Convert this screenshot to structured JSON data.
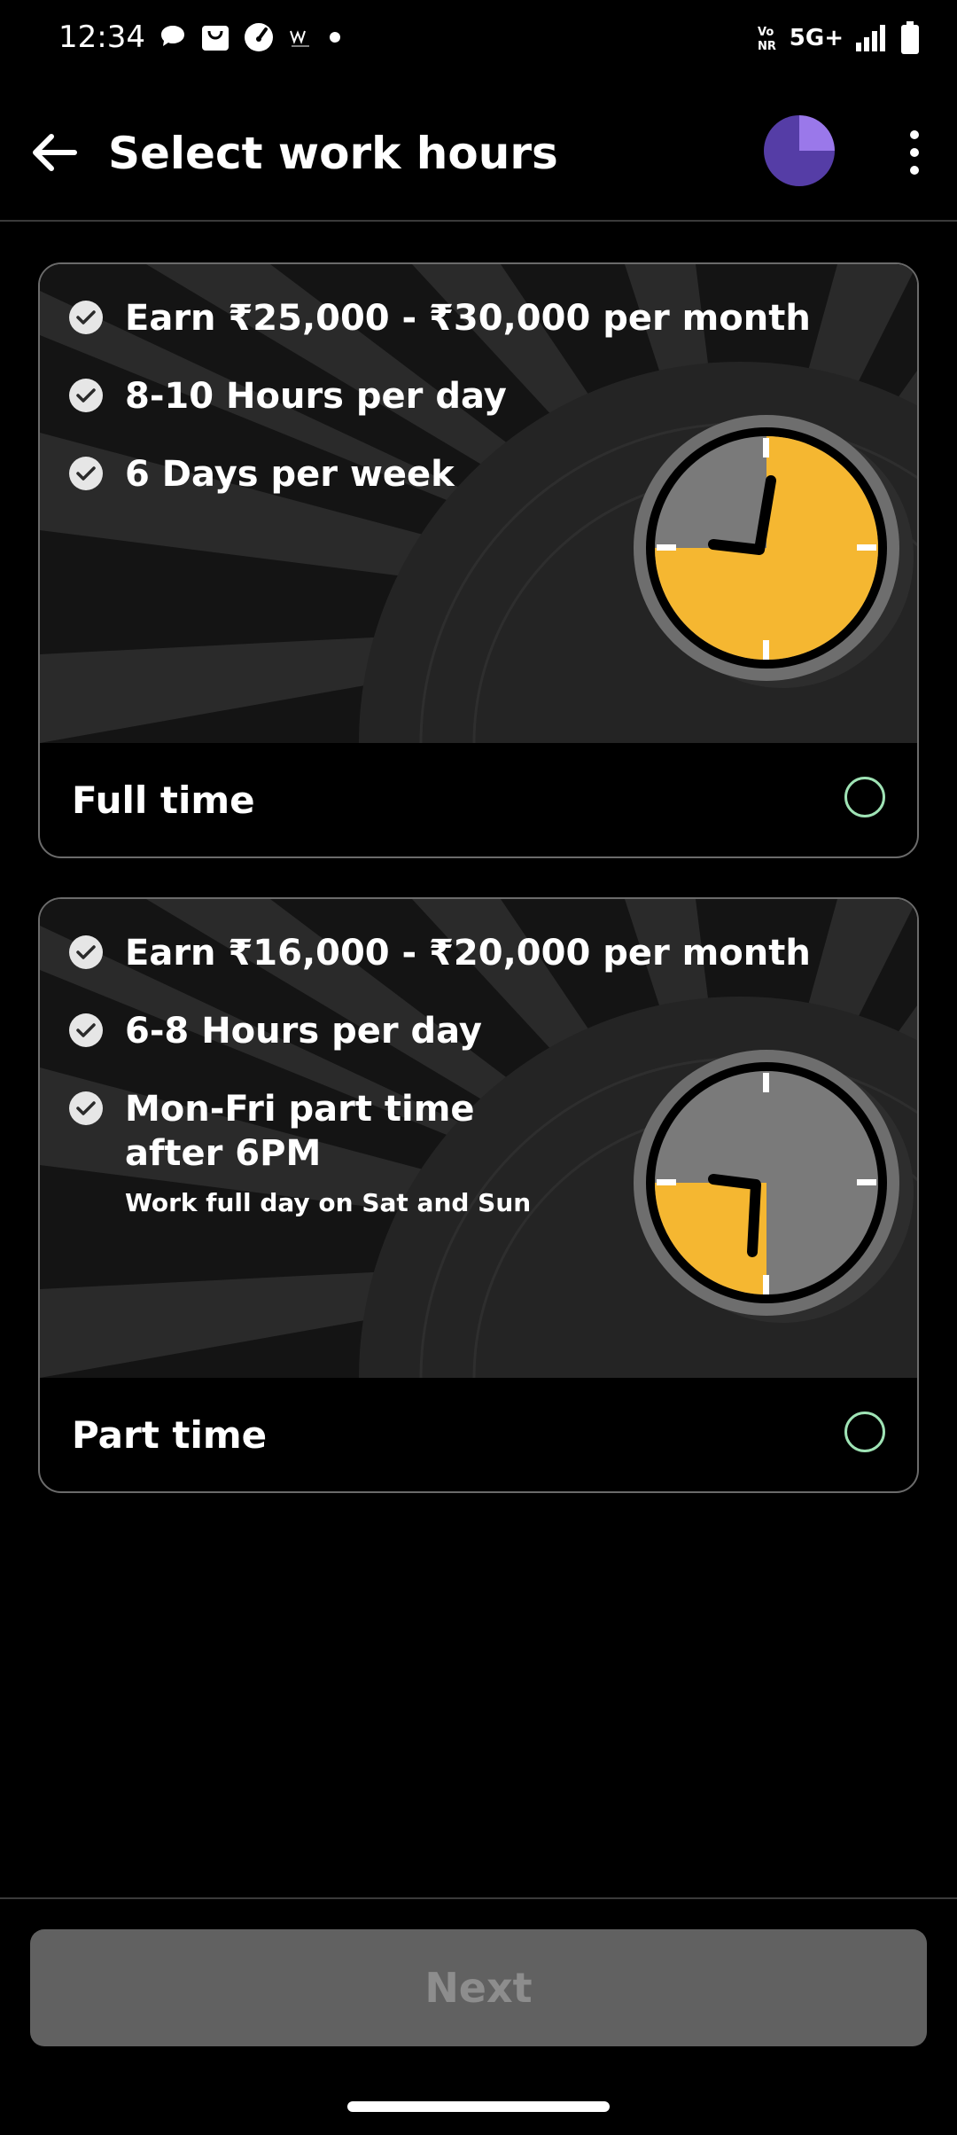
{
  "status": {
    "time": "12:34",
    "network": "5G+",
    "volte": "Vo NR"
  },
  "header": {
    "title": "Select work hours"
  },
  "options": [
    {
      "label": "Full time",
      "features": [
        "Earn ₹25,000 - ₹30,000 per month",
        "8-10 Hours per day",
        "6 Days per week"
      ],
      "selected": false
    },
    {
      "label": "Part time",
      "features": [
        "Earn ₹16,000 - ₹20,000 per month",
        "6-8 Hours per day",
        "Mon-Fri part time after 6PM"
      ],
      "feature_note": "Work full day on Sat and Sun",
      "selected": false
    }
  ],
  "colors": {
    "clock_face": "#F5B731",
    "clock_grey": "#7A7A7A",
    "radio_outline": "#9FE3B5",
    "avatar_light": "#9A78EA",
    "avatar_dark": "#553DA6"
  },
  "footer": {
    "next_label": "Next"
  }
}
